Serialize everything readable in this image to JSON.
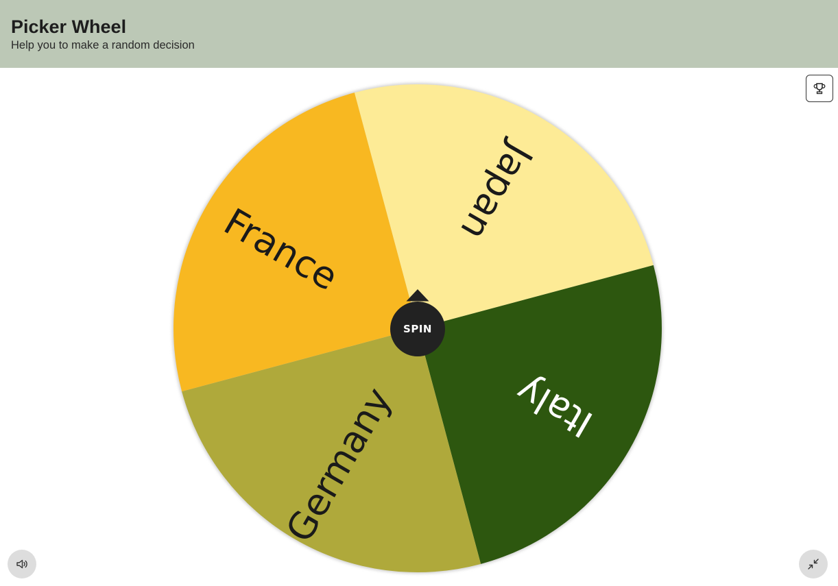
{
  "header": {
    "title": "Picker Wheel",
    "subtitle": "Help you to make a random decision"
  },
  "wheel": {
    "spin_label": "SPIN",
    "rotation_offset_deg": -15,
    "pointer_color": "#222222",
    "segments": [
      {
        "label": "Japan",
        "color": "#fdeb96",
        "text_color": "#1a1a1a"
      },
      {
        "label": "Italy",
        "color": "#2d570f",
        "text_color": "#ffffff"
      },
      {
        "label": "Germany",
        "color": "#afa93b",
        "text_color": "#1a1a1a"
      },
      {
        "label": "France",
        "color": "#f8b821",
        "text_color": "#1a1a1a"
      }
    ]
  },
  "toolbar": {
    "trophy_icon": "trophy-icon",
    "sound_icon": "speaker-icon",
    "collapse_icon": "collapse-icon"
  }
}
